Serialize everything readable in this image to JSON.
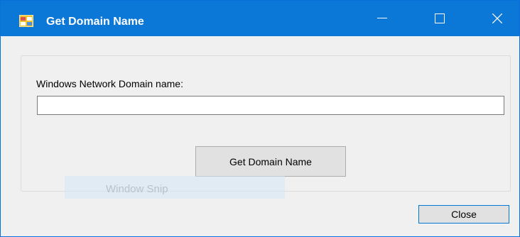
{
  "window": {
    "title": "Get Domain Name",
    "controls": [
      "minimize",
      "maximize",
      "close"
    ],
    "icon": "app-form-icon",
    "accent_color": "#0b78d7"
  },
  "form": {
    "field_label": "Windows Network Domain name:",
    "field_value": "",
    "get_button_label": "Get Domain Name",
    "close_button_label": "Close"
  },
  "overlay": {
    "text": "Window Snip"
  }
}
